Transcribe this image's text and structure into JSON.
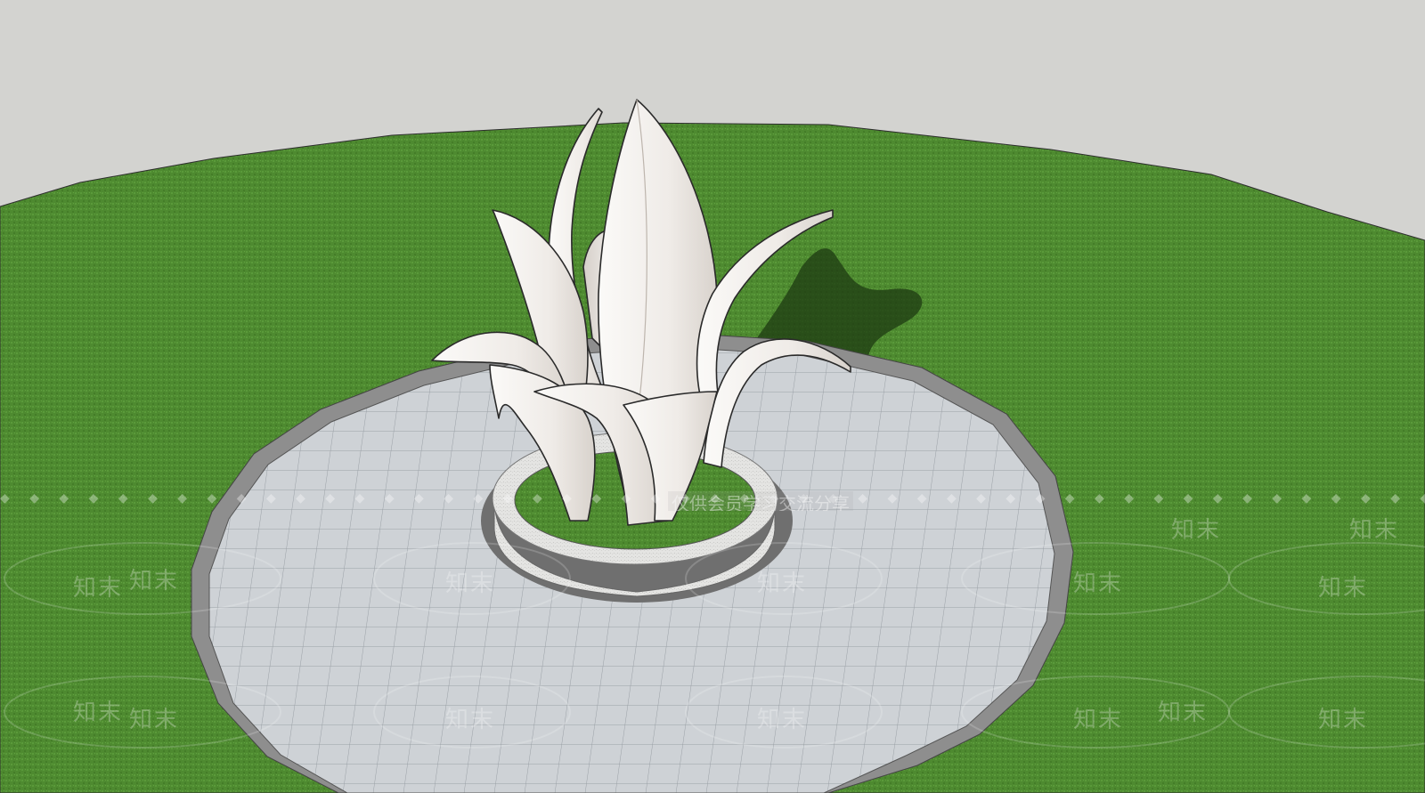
{
  "scene": {
    "type": "3d-model-viewport",
    "subject": "white petal sculpture on circular tiled plaza",
    "colors": {
      "sky": "#d3d3d0",
      "lawn": "#4e8a30",
      "lawn_dark": "#3f7526",
      "plaza": "#ced2d6",
      "plaza_border": "#8e8e8e",
      "planter_rim": "#e6e6e4",
      "petal": "#f4f1ee",
      "petal_shade": "#d9d4cf",
      "shadow": "#1e3a12"
    }
  },
  "watermark": {
    "mark": "知末",
    "banner_caption": "仅供会员学习交流分享",
    "banner_diamonds": "◆ ◆ ◆ ◆ ◆ ◆ ◆ ◆ ◆ ◆ ◆ ◆ ◆ ◆ ◆ ◆ ◆ ◆ ◆ ◆ ◆ ◆ ◆ ◆ ◆ ◆ ◆ ◆ ◆ ◆ ◆ ◆ ◆ ◆ ◆ ◆ ◆ ◆ ◆ ◆ ◆ ◆ ◆ ◆ ◆ ◆ ◆ ◆ ◆ ◆ ◆ ◆ ◆ ◆ ◆ ◆ ◆ ◆ ◆ ◆ ◆ ◆ ◆ ◆ ◆ ◆ ◆ ◆ ◆ ◆ ◆ ◆ ◆ ◆ ◆"
  }
}
